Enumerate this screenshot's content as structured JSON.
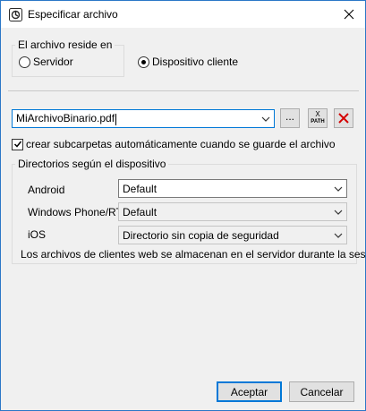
{
  "window": {
    "title": "Especificar archivo",
    "icon": "altova-app-icon",
    "close_icon": "close-icon"
  },
  "location_group": {
    "legend": "El archivo reside en",
    "options": [
      {
        "label": "Servidor",
        "checked": false
      },
      {
        "label": "Dispositivo cliente",
        "checked": true
      }
    ]
  },
  "file": {
    "value": "MiArchivoBinario.pdf",
    "browse_label": "...",
    "xpath_label_top": "X",
    "xpath_label_bottom": "PATH",
    "clear_icon": "red-x-icon"
  },
  "create_subfolders": {
    "checked": true,
    "label": "crear subcarpetas automáticamente cuando se guarde el archivo"
  },
  "device_dirs": {
    "legend": "Directorios según el dispositivo",
    "rows": [
      {
        "label": "Android",
        "value": "Default",
        "enabled": true
      },
      {
        "label": "Windows Phone/RT",
        "value": "Default",
        "enabled": false
      },
      {
        "label": "iOS",
        "value": "Directorio sin copia de seguridad",
        "enabled": false
      }
    ],
    "note": "Los archivos de clientes web se almacenan en el servidor durante la sesión"
  },
  "buttons": {
    "accept": "Aceptar",
    "cancel": "Cancelar"
  },
  "colors": {
    "accent": "#0078d7",
    "clear_red": "#d40000"
  }
}
